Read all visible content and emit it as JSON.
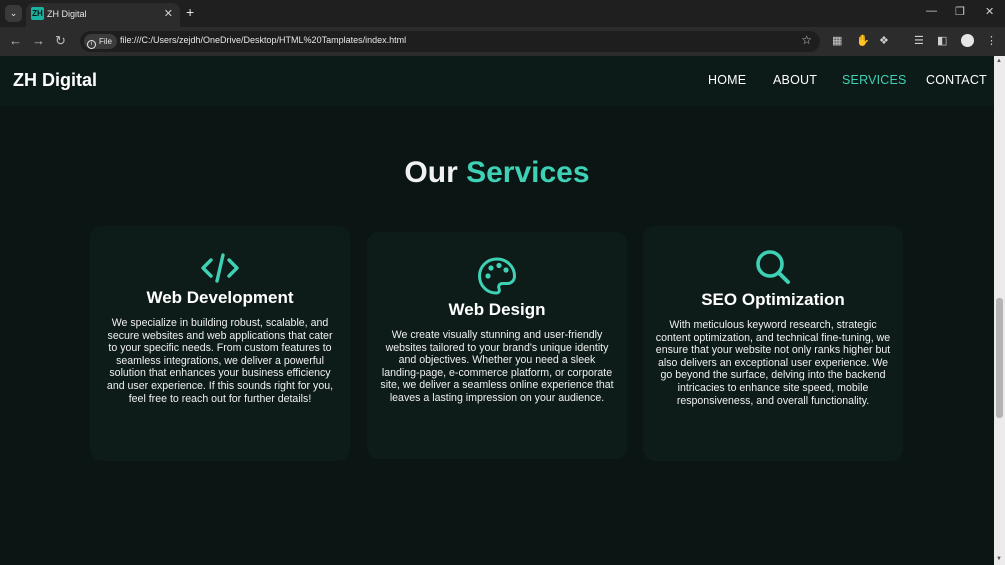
{
  "browser": {
    "tab_title": "ZH Digital",
    "tab_favicon": "ZH",
    "url_scheme_label": "File",
    "url": "file:///C:/Users/zejdh/OneDrive/Desktop/HTML%20Tamplates/index.html"
  },
  "site": {
    "brand": "ZH Digital",
    "nav": [
      "HOME",
      "ABOUT",
      "SERVICES",
      "CONTACT"
    ],
    "active_nav": "SERVICES",
    "accent_color": "#3ed1b5"
  },
  "services": {
    "title_prefix": "Our",
    "title_accent": "Services",
    "cards": [
      {
        "icon": "code-icon",
        "title": "Web Development",
        "text": "We specialize in building robust, scalable, and secure websites and web applications that cater to your specific needs. From custom features to seamless integrations, we deliver a powerful solution that enhances your business efficiency and user experience. If this sounds right for you, feel free to reach out for further details!"
      },
      {
        "icon": "palette-icon",
        "title": "Web Design",
        "text": "We create visually stunning and user-friendly websites tailored to your brand's unique identity and objectives. Whether you need a sleek landing-page, e-commerce platform, or corporate site, we deliver a seamless online experience that leaves a lasting impression on your audience."
      },
      {
        "icon": "search-icon",
        "title": "SEO Optimization",
        "text": "With meticulous keyword research, strategic content optimization, and technical fine-tuning, we ensure that your website not only ranks higher but also delivers an exceptional user experience. We go beyond the surface, delving into the backend intricacies to enhance site speed, mobile responsiveness, and overall functionality."
      }
    ]
  }
}
